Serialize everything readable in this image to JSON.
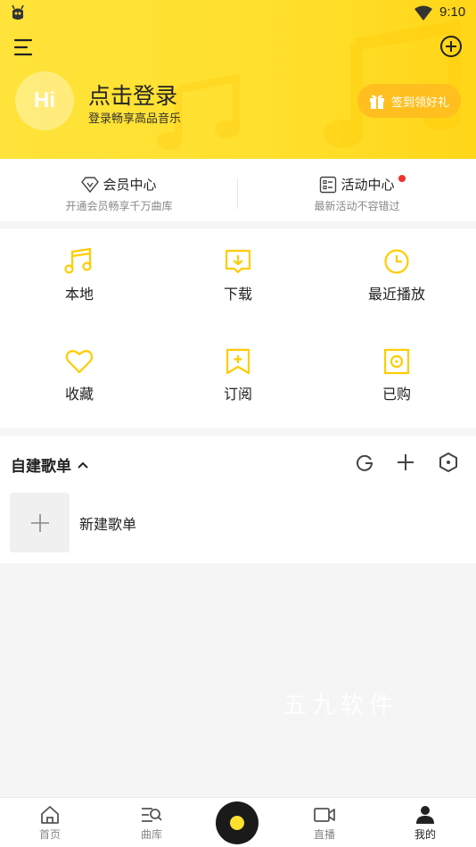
{
  "status": {
    "time": "9:10"
  },
  "header": {
    "avatar_text": "Hi",
    "login_title": "点击登录",
    "login_subtitle": "登录畅享高品音乐",
    "gift_button": "签到领好礼"
  },
  "member": {
    "vip_title": "会员中心",
    "vip_sub": "开通会员畅享千万曲库",
    "activity_title": "活动中心",
    "activity_sub": "最新活动不容错过"
  },
  "grid": {
    "items": [
      {
        "label": "本地",
        "icon": "music-note-icon"
      },
      {
        "label": "下载",
        "icon": "download-icon"
      },
      {
        "label": "最近播放",
        "icon": "clock-icon"
      },
      {
        "label": "收藏",
        "icon": "heart-icon"
      },
      {
        "label": "订阅",
        "icon": "bookmark-plus-icon"
      },
      {
        "label": "已购",
        "icon": "purchased-icon"
      }
    ]
  },
  "playlist": {
    "title": "自建歌单",
    "new_label": "新建歌单"
  },
  "watermark": "五九软件",
  "bottom_nav": {
    "items": [
      {
        "label": "首页"
      },
      {
        "label": "曲库"
      },
      {
        "label": "直播"
      },
      {
        "label": "我的"
      }
    ]
  },
  "colors": {
    "accent": "#ffe02e",
    "gift": "#ffbf1f",
    "icon_yellow": "#ffcc00"
  }
}
